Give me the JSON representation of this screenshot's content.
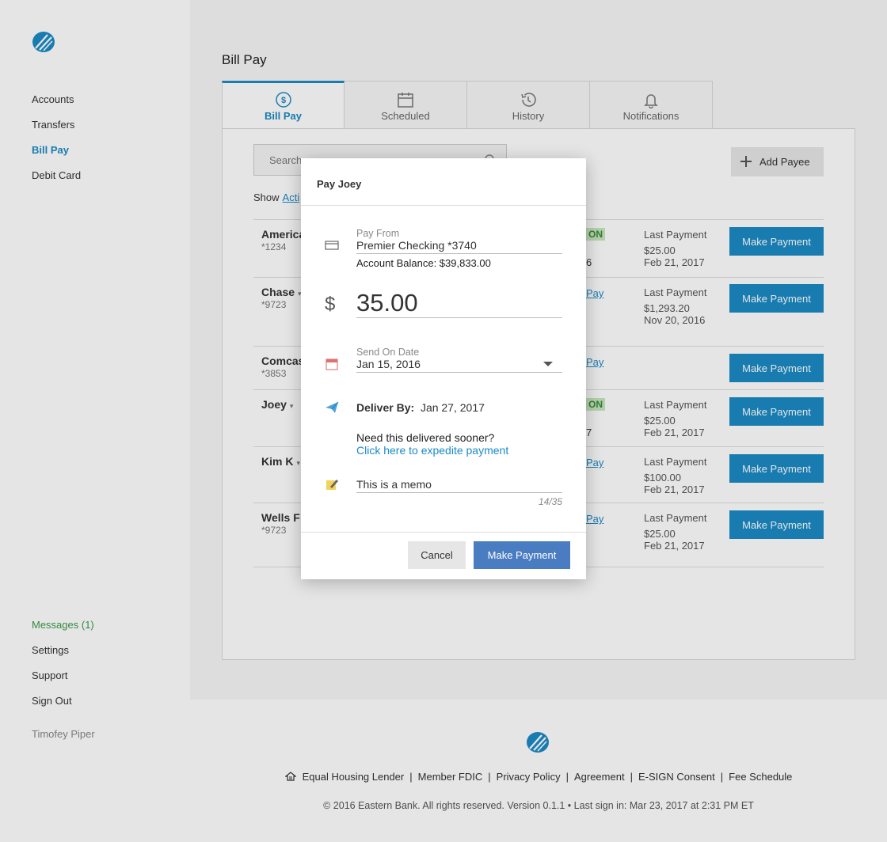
{
  "sidebar": {
    "nav": [
      "Accounts",
      "Transfers",
      "Bill Pay",
      "Debit Card"
    ],
    "active": "Bill Pay",
    "bottom": [
      "Messages (1)",
      "Settings",
      "Support",
      "Sign Out"
    ],
    "user": "Timofey Piper"
  },
  "colors": {
    "accent": "#1b8bc6",
    "messages": "#3a9b4a",
    "modal_button": "#4a7cc2"
  },
  "page": {
    "title": "Bill Pay",
    "tabs": [
      {
        "label": "Bill Pay",
        "icon": "dollar-circle-icon"
      },
      {
        "label": "Scheduled",
        "icon": "calendar-icon"
      },
      {
        "label": "History",
        "icon": "history-icon"
      },
      {
        "label": "Notifications",
        "icon": "bell-icon"
      }
    ],
    "search_placeholder": "Search",
    "add_payee": "Add Payee",
    "show_label": "Show",
    "show_link": "Acti",
    "make_payment": "Make Payment",
    "payees": [
      {
        "name": "America",
        "acct": "*1234",
        "caret": false,
        "mid_type": "badge",
        "mid": "ON",
        "mid2": "6",
        "last_label": "Last Payment",
        "last_amt": "$25.00",
        "last_date": "Feb 21, 2017"
      },
      {
        "name": "Chase",
        "acct": "*9723",
        "caret": true,
        "mid_type": "link",
        "mid": "Pay",
        "mid2": "",
        "last_label": "Last Payment",
        "last_amt": "$1,293.20",
        "last_date": "Nov 20, 2016"
      },
      {
        "name": "Comcas",
        "acct": "*3853",
        "caret": false,
        "mid_type": "link",
        "mid": "Pay",
        "mid2": "",
        "last_label": "",
        "last_amt": "",
        "last_date": ""
      },
      {
        "name": "Joey",
        "acct": "",
        "caret": true,
        "mid_type": "badge",
        "mid": "ON",
        "mid2": "7",
        "last_label": "Last Payment",
        "last_amt": "$25.00",
        "last_date": "Feb 21, 2017"
      },
      {
        "name": "Kim K",
        "acct": "",
        "caret": true,
        "mid_type": "link",
        "mid": "Pay",
        "mid2": "",
        "last_label": "Last Payment",
        "last_amt": "$100.00",
        "last_date": "Feb 21, 2017"
      },
      {
        "name": "Wells F",
        "acct": "*9723",
        "caret": false,
        "mid_type": "link",
        "mid": "Pay",
        "mid2": "",
        "last_label": "Last Payment",
        "last_amt": "$25.00",
        "last_date": "Feb 21, 2017"
      }
    ]
  },
  "footer": {
    "links": [
      "Equal Housing Lender",
      "Member FDIC",
      "Privacy Policy",
      "Agreement",
      "E-SIGN Consent",
      "Fee Schedule"
    ],
    "copyright": "© 2016 Eastern Bank. All rights reserved. Version 0.1.1 • Last sign in: Mar 23, 2017 at 2:31 PM ET"
  },
  "modal": {
    "title": "Pay Joey",
    "pay_from_label": "Pay From",
    "pay_from_value": "Premier Checking *3740",
    "balance": "Account Balance: $39,833.00",
    "currency": "$",
    "amount": "35.00",
    "send_label": "Send On Date",
    "send_value": "Jan 15, 2016",
    "deliver_label": "Deliver By:",
    "deliver_value": "Jan 27, 2017",
    "sooner": "Need this delivered sooner?",
    "expedite": "Click here to expedite payment",
    "memo": "This is a memo",
    "counter": "14/35",
    "cancel": "Cancel",
    "submit": "Make Payment"
  }
}
